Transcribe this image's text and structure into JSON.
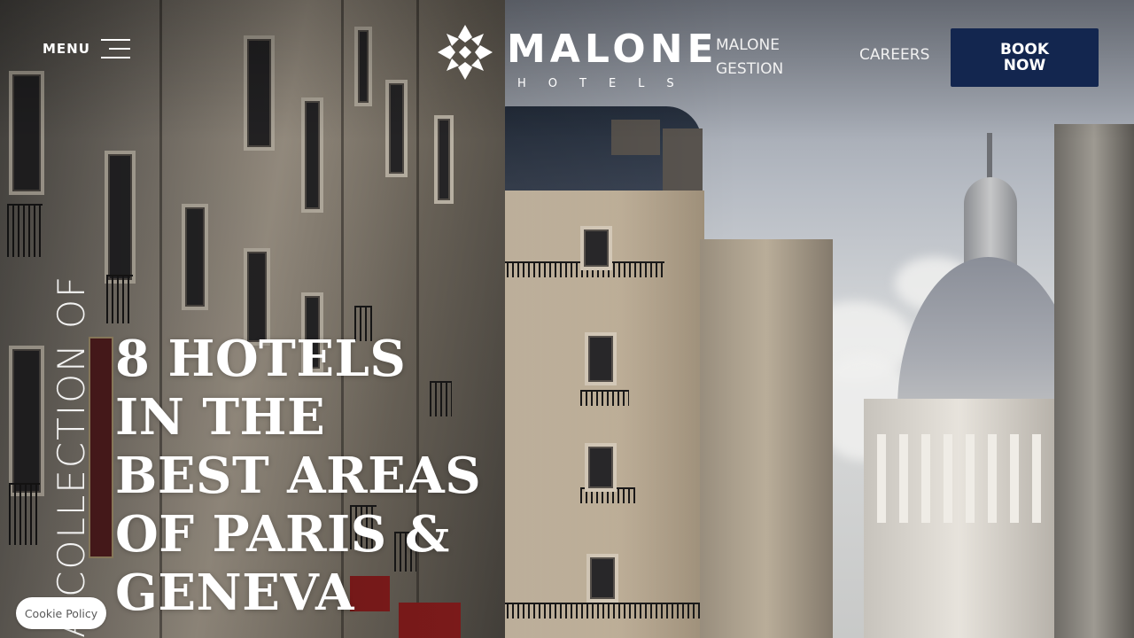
{
  "header": {
    "menu_label": "MENU",
    "brand": {
      "name": "MALONE",
      "subtitle": "HOTELS"
    },
    "nav": {
      "gestion_label": "MALONE GESTION",
      "careers_label": "CAREERS"
    },
    "book_label": "BOOK NOW",
    "book_color": "#13264f"
  },
  "hero": {
    "vertical_text": "A COLLECTION OF",
    "headline": "8 HOTELS IN THE BEST AREAS OF PARIS & GENEVA"
  },
  "footer": {
    "cookie_label": "Cookie Policy"
  },
  "icons": {
    "menu": "hamburger-icon",
    "logo": "star-cross-logo-mark"
  }
}
